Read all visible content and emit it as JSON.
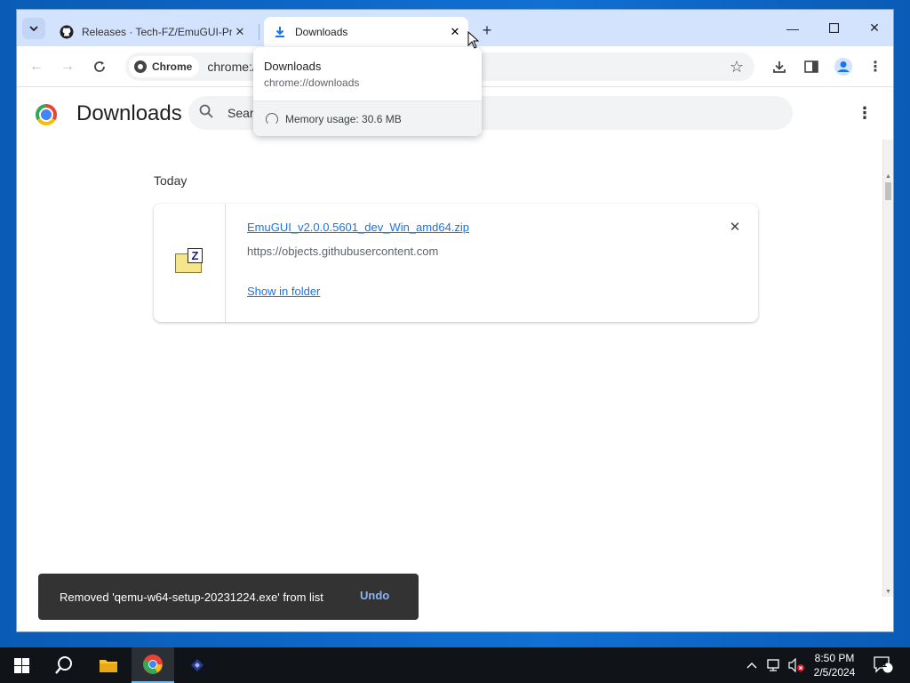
{
  "browser": {
    "tabs": [
      {
        "title": "Releases · Tech-FZ/EmuGUI-Pre",
        "favicon": "github-icon"
      },
      {
        "title": "Downloads",
        "favicon": "download-icon"
      }
    ],
    "omnibox": {
      "chip_label": "Chrome",
      "url": "chrome://"
    }
  },
  "hovercard": {
    "title": "Downloads",
    "url": "chrome://downloads",
    "memory": "Memory usage: 30.6 MB"
  },
  "page": {
    "title": "Downloads",
    "search_placeholder": "Search downloads",
    "search_value": "Searc",
    "section": "Today",
    "download": {
      "filename": "EmuGUI_v2.0.0.5601_dev_Win_amd64.zip",
      "source": "https://objects.githubusercontent.com",
      "action": "Show in folder"
    }
  },
  "toast": {
    "message": "Removed 'qemu-w64-setup-20231224.exe' from list",
    "action": "Undo"
  },
  "taskbar": {
    "time": "8:50 PM",
    "date": "2/5/2024",
    "notification_count": "1"
  },
  "colors": {
    "accent": "#1a73e8",
    "tabstrip": "#d3e3fd",
    "taskbar": "#101317"
  }
}
